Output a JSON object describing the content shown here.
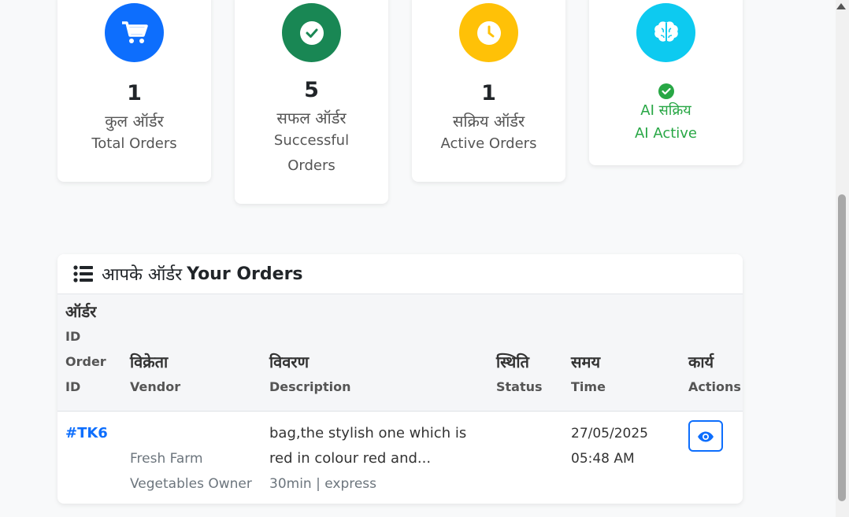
{
  "stats": [
    {
      "icon": "cart-icon",
      "color": "#0d6efd",
      "value": "1",
      "label_hi": "कुल ऑर्डर",
      "label_en": "Total Orders"
    },
    {
      "icon": "check-icon",
      "color": "#198754",
      "value": "5",
      "label_hi": "सफल ऑर्डर",
      "label_en": "Successful Orders"
    },
    {
      "icon": "clock-icon",
      "color": "#ffc107",
      "value": "1",
      "label_hi": "सक्रिय ऑर्डर",
      "label_en": "Active Orders"
    },
    {
      "icon": "brain-icon",
      "color": "#0dcaf0",
      "label_hi": "AI सक्रिय",
      "label_en": "AI Active",
      "status_color": "#28a745"
    }
  ],
  "orders": {
    "title_hi": "आपके ऑर्डर",
    "title_en": "Your Orders",
    "columns": [
      {
        "hi": "ऑर्डर",
        "hi2": "ID",
        "en": "Order ID"
      },
      {
        "hi": "विक्रेता",
        "en": "Vendor"
      },
      {
        "hi": "विवरण",
        "en": "Description"
      },
      {
        "hi": "स्थिति",
        "en": "Status"
      },
      {
        "hi": "समय",
        "en": "Time"
      },
      {
        "hi": "कार्य",
        "en": "Actions"
      }
    ],
    "rows": [
      {
        "id": "#TK6",
        "vendor": "Fresh Farm Vegetables Owner",
        "description": "bag,the stylish one which is red in colour red and...",
        "meta": "30min | express",
        "status": "",
        "date": "27/05/2025",
        "time": "05:48 AM"
      }
    ]
  }
}
